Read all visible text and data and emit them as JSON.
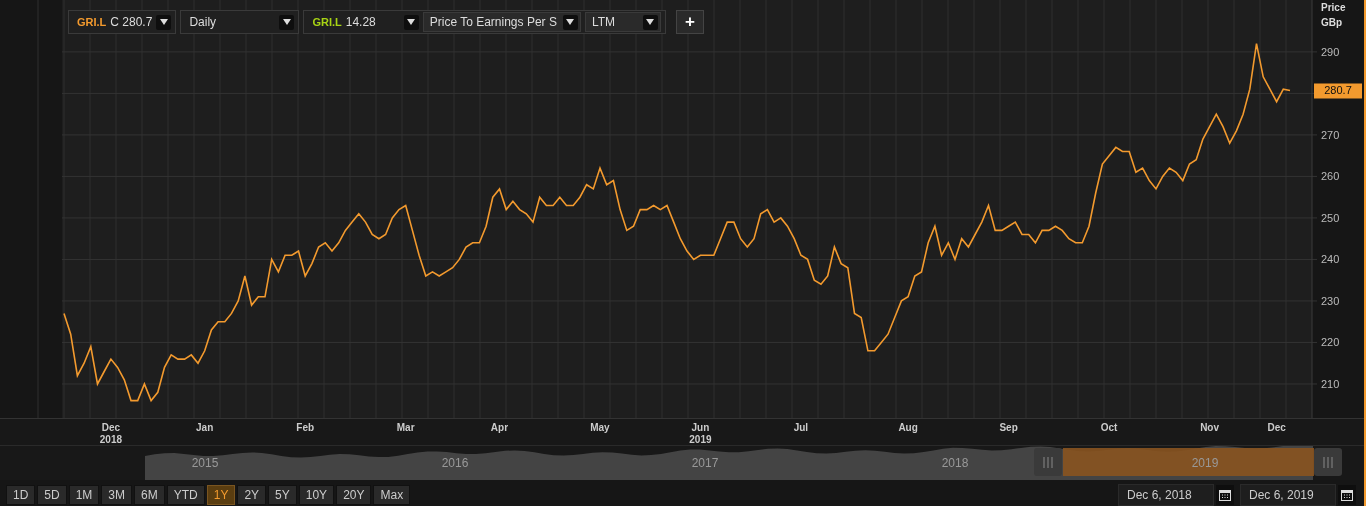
{
  "main_series": {
    "ticker": "GRI.L",
    "color": "#f39a2e",
    "value": "C 280.7"
  },
  "interval": {
    "value": "Daily"
  },
  "indicator": {
    "ticker": "GRI.L",
    "color": "#a8d414",
    "value": "14.28",
    "metric": "Price To Earnings Per S",
    "period": "LTM"
  },
  "add_button": "+",
  "axis": {
    "title": "Price",
    "unit": "GBp"
  },
  "last_price": "280.7",
  "chart_data": {
    "type": "line",
    "grid": true,
    "ylim": [
      201.8,
      302.5
    ],
    "yticks": [
      210,
      220,
      230,
      240,
      250,
      260,
      270,
      290
    ],
    "categories": [
      null,
      null,
      null,
      null,
      null,
      null,
      null,
      "Dec",
      null,
      null,
      null,
      null,
      null,
      null,
      null,
      null,
      null,
      null,
      null,
      null,
      null,
      "Jan",
      null,
      null,
      null,
      null,
      null,
      null,
      null,
      null,
      null,
      null,
      null,
      null,
      null,
      null,
      "Feb",
      null,
      null,
      null,
      null,
      null,
      null,
      null,
      null,
      null,
      null,
      null,
      null,
      null,
      null,
      "Mar",
      null,
      null,
      null,
      null,
      null,
      null,
      null,
      null,
      null,
      null,
      null,
      null,
      null,
      "Apr",
      null,
      null,
      null,
      null,
      null,
      null,
      null,
      null,
      null,
      null,
      null,
      null,
      null,
      null,
      "May",
      null,
      null,
      null,
      null,
      null,
      null,
      null,
      null,
      null,
      null,
      null,
      null,
      null,
      null,
      "Jun",
      null,
      null,
      null,
      null,
      null,
      null,
      null,
      null,
      null,
      null,
      null,
      null,
      null,
      null,
      "Jul",
      null,
      null,
      null,
      null,
      null,
      null,
      null,
      null,
      null,
      null,
      null,
      null,
      null,
      null,
      null,
      "Aug",
      null,
      null,
      null,
      null,
      null,
      null,
      null,
      null,
      null,
      null,
      null,
      null,
      null,
      null,
      "Sep",
      null,
      null,
      null,
      null,
      null,
      null,
      null,
      null,
      null,
      null,
      null,
      null,
      null,
      null,
      "Oct",
      null,
      null,
      null,
      null,
      null,
      null,
      null,
      null,
      null,
      null,
      null,
      null,
      null,
      null,
      "Nov",
      null,
      null,
      null,
      null,
      null,
      null,
      null,
      null,
      null,
      "Dec",
      null,
      null
    ],
    "series": [
      {
        "color": "#f39a2e",
        "values": [
          227,
          222,
          212,
          215,
          219,
          210,
          213,
          216,
          214,
          211,
          206,
          206,
          210,
          206,
          208,
          214,
          217,
          216,
          216,
          217,
          215,
          218,
          223,
          225,
          225,
          227,
          230,
          236,
          229,
          231,
          231,
          240,
          237,
          241,
          241,
          242,
          236,
          239,
          243,
          244,
          242,
          244,
          247,
          249,
          251,
          249,
          246,
          245,
          246,
          250,
          252,
          253,
          247,
          241,
          236,
          237,
          236,
          237,
          238,
          240,
          243,
          244,
          244,
          248,
          255,
          257,
          252,
          254,
          252,
          251,
          249,
          255,
          253,
          253,
          255,
          253,
          253,
          255,
          258,
          257,
          262,
          258,
          259,
          252,
          247,
          248,
          252,
          252,
          253,
          252,
          253,
          249,
          245,
          242,
          240,
          241,
          241,
          241,
          245,
          249,
          249,
          245,
          243,
          245,
          251,
          252,
          249,
          250,
          248,
          245,
          241,
          240,
          235,
          234,
          236,
          243,
          239,
          238,
          227,
          226,
          218,
          218,
          220,
          222,
          226,
          230,
          231,
          236,
          237,
          244,
          248,
          241,
          244,
          240,
          245,
          243,
          246,
          249,
          253,
          247,
          247,
          248,
          249,
          246,
          246,
          244,
          247,
          247,
          248,
          247,
          245,
          244,
          244,
          248,
          256,
          263,
          265,
          267,
          266,
          266,
          261,
          262,
          259,
          257,
          260,
          262,
          261,
          259,
          263,
          264,
          269,
          272,
          275,
          272,
          268,
          271,
          275,
          281,
          292,
          284,
          281,
          278,
          281,
          280.7
        ]
      }
    ]
  },
  "year_labels": [
    "2018",
    "2019"
  ],
  "navigator": {
    "years": [
      "2015",
      "2016",
      "2017",
      "2018",
      "2019"
    ]
  },
  "ranges": [
    {
      "label": "1D",
      "selected": false
    },
    {
      "label": "5D",
      "selected": false
    },
    {
      "label": "1M",
      "selected": false
    },
    {
      "label": "3M",
      "selected": false
    },
    {
      "label": "6M",
      "selected": false
    },
    {
      "label": "YTD",
      "selected": false
    },
    {
      "label": "1Y",
      "selected": true
    },
    {
      "label": "2Y",
      "selected": false
    },
    {
      "label": "5Y",
      "selected": false
    },
    {
      "label": "10Y",
      "selected": false
    },
    {
      "label": "20Y",
      "selected": false
    },
    {
      "label": "Max",
      "selected": false
    }
  ],
  "date_from": "Dec 6, 2018",
  "date_to": "Dec 6, 2019"
}
